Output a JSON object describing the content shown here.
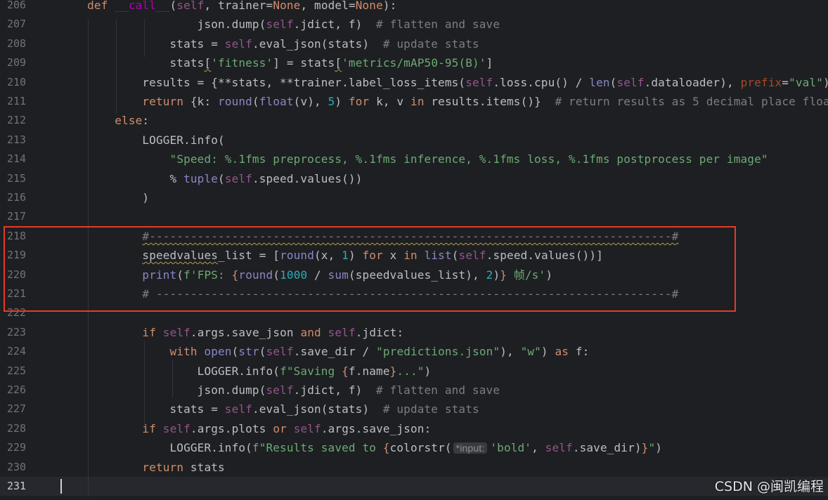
{
  "editor": {
    "current_line": "231",
    "lines": [
      {
        "n": "206",
        "tokens": [
          {
            "t": "    ",
            "c": ""
          },
          {
            "t": "def",
            "c": "kw"
          },
          {
            "t": " ",
            "c": ""
          },
          {
            "t": "__call__",
            "c": "dn"
          },
          {
            "t": "(",
            "c": ""
          },
          {
            "t": "self",
            "c": "sf"
          },
          {
            "t": ", trainer=",
            "c": ""
          },
          {
            "t": "None",
            "c": "kw"
          },
          {
            "t": ", model=",
            "c": ""
          },
          {
            "t": "None",
            "c": "kw"
          },
          {
            "t": "):",
            "c": ""
          }
        ]
      },
      {
        "n": "207",
        "tokens": [
          {
            "t": "                    json.dump(",
            "c": ""
          },
          {
            "t": "self",
            "c": "sf"
          },
          {
            "t": ".jdict, f)  ",
            "c": ""
          },
          {
            "t": "# flatten and save",
            "c": "cm"
          }
        ]
      },
      {
        "n": "208",
        "tokens": [
          {
            "t": "                stats = ",
            "c": ""
          },
          {
            "t": "self",
            "c": "sf"
          },
          {
            "t": ".eval_json(stats)  ",
            "c": ""
          },
          {
            "t": "# update stats",
            "c": "cm"
          }
        ]
      },
      {
        "n": "209",
        "tokens": [
          {
            "t": "                stats",
            "c": ""
          },
          {
            "t": "[",
            "c": "wv"
          },
          {
            "t": "'fitness'",
            "c": "st"
          },
          {
            "t": "] = stats",
            "c": ""
          },
          {
            "t": "[",
            "c": "wv"
          },
          {
            "t": "'metrics/mAP50-95(B)'",
            "c": "st"
          },
          {
            "t": "]",
            "c": ""
          }
        ]
      },
      {
        "n": "210",
        "tokens": [
          {
            "t": "            results = {**stats, **trainer.label_loss_items(",
            "c": ""
          },
          {
            "t": "self",
            "c": "sf"
          },
          {
            "t": ".loss.cpu() / ",
            "c": ""
          },
          {
            "t": "len",
            "c": "bi"
          },
          {
            "t": "(",
            "c": ""
          },
          {
            "t": "self",
            "c": "sf"
          },
          {
            "t": ".dataloader), ",
            "c": ""
          },
          {
            "t": "prefix",
            "c": "pm"
          },
          {
            "t": "=",
            "c": ""
          },
          {
            "t": "\"val\"",
            "c": "st"
          },
          {
            "t": ")}",
            "c": ""
          }
        ]
      },
      {
        "n": "211",
        "tokens": [
          {
            "t": "            ",
            "c": ""
          },
          {
            "t": "return",
            "c": "kw"
          },
          {
            "t": " {k: ",
            "c": ""
          },
          {
            "t": "round",
            "c": "bi"
          },
          {
            "t": "(",
            "c": ""
          },
          {
            "t": "float",
            "c": "bi"
          },
          {
            "t": "(v), ",
            "c": ""
          },
          {
            "t": "5",
            "c": "nm"
          },
          {
            "t": ") ",
            "c": ""
          },
          {
            "t": "for",
            "c": "kw"
          },
          {
            "t": " k, v ",
            "c": ""
          },
          {
            "t": "in",
            "c": "kw"
          },
          {
            "t": " results.items()}  ",
            "c": ""
          },
          {
            "t": "# return results as 5 decimal place floats",
            "c": "cm"
          }
        ]
      },
      {
        "n": "212",
        "tokens": [
          {
            "t": "        ",
            "c": ""
          },
          {
            "t": "else",
            "c": "kw"
          },
          {
            "t": ":",
            "c": ""
          }
        ]
      },
      {
        "n": "213",
        "tokens": [
          {
            "t": "            LOGGER.info(",
            "c": ""
          }
        ]
      },
      {
        "n": "214",
        "tokens": [
          {
            "t": "                ",
            "c": ""
          },
          {
            "t": "\"Speed: %.1fms preprocess, %.1fms inference, %.1fms loss, %.1fms postprocess per image\"",
            "c": "st"
          }
        ]
      },
      {
        "n": "215",
        "tokens": [
          {
            "t": "                % ",
            "c": ""
          },
          {
            "t": "tuple",
            "c": "bi"
          },
          {
            "t": "(",
            "c": ""
          },
          {
            "t": "self",
            "c": "sf"
          },
          {
            "t": ".speed.values())",
            "c": ""
          }
        ]
      },
      {
        "n": "216",
        "tokens": [
          {
            "t": "            )",
            "c": ""
          }
        ]
      },
      {
        "n": "217",
        "tokens": []
      },
      {
        "n": "218",
        "tokens": [
          {
            "t": "            ",
            "c": ""
          },
          {
            "t": "#----------------------------------------------------------------------------#",
            "c": "cm wv"
          }
        ]
      },
      {
        "n": "219",
        "tokens": [
          {
            "t": "            ",
            "c": ""
          },
          {
            "t": "speedvalues",
            "c": "wv"
          },
          {
            "t": "_list = [",
            "c": ""
          },
          {
            "t": "round",
            "c": "bi"
          },
          {
            "t": "(x, ",
            "c": ""
          },
          {
            "t": "1",
            "c": "nm"
          },
          {
            "t": ") ",
            "c": ""
          },
          {
            "t": "for",
            "c": "kw"
          },
          {
            "t": " x ",
            "c": ""
          },
          {
            "t": "in",
            "c": "kw"
          },
          {
            "t": " ",
            "c": ""
          },
          {
            "t": "list",
            "c": "bi"
          },
          {
            "t": "(",
            "c": ""
          },
          {
            "t": "self",
            "c": "sf"
          },
          {
            "t": ".speed.values())]",
            "c": ""
          }
        ]
      },
      {
        "n": "220",
        "tokens": [
          {
            "t": "            ",
            "c": ""
          },
          {
            "t": "print",
            "c": "bi"
          },
          {
            "t": "(",
            "c": ""
          },
          {
            "t": "f'FPS: ",
            "c": "st"
          },
          {
            "t": "{",
            "c": "kw"
          },
          {
            "t": "round",
            "c": "bi"
          },
          {
            "t": "(",
            "c": ""
          },
          {
            "t": "1000",
            "c": "nm"
          },
          {
            "t": " / ",
            "c": ""
          },
          {
            "t": "sum",
            "c": "bi"
          },
          {
            "t": "(speedvalues_list), ",
            "c": ""
          },
          {
            "t": "2",
            "c": "nm"
          },
          {
            "t": ")",
            "c": ""
          },
          {
            "t": "}",
            "c": "kw"
          },
          {
            "t": " 帧/s'",
            "c": "st"
          },
          {
            "t": ")",
            "c": ""
          }
        ]
      },
      {
        "n": "221",
        "tokens": [
          {
            "t": "            ",
            "c": ""
          },
          {
            "t": "# ---------------------------------------------------------------------------#",
            "c": "cm"
          }
        ]
      },
      {
        "n": "222",
        "tokens": []
      },
      {
        "n": "223",
        "tokens": [
          {
            "t": "            ",
            "c": ""
          },
          {
            "t": "if",
            "c": "kw"
          },
          {
            "t": " ",
            "c": ""
          },
          {
            "t": "self",
            "c": "sf"
          },
          {
            "t": ".args.save_json ",
            "c": ""
          },
          {
            "t": "and",
            "c": "kw"
          },
          {
            "t": " ",
            "c": ""
          },
          {
            "t": "self",
            "c": "sf"
          },
          {
            "t": ".jdict:",
            "c": ""
          }
        ]
      },
      {
        "n": "224",
        "tokens": [
          {
            "t": "                ",
            "c": ""
          },
          {
            "t": "with",
            "c": "kw"
          },
          {
            "t": " ",
            "c": ""
          },
          {
            "t": "open",
            "c": "bi"
          },
          {
            "t": "(",
            "c": ""
          },
          {
            "t": "str",
            "c": "bi"
          },
          {
            "t": "(",
            "c": ""
          },
          {
            "t": "self",
            "c": "sf"
          },
          {
            "t": ".save_dir / ",
            "c": ""
          },
          {
            "t": "\"predictions.json\"",
            "c": "st"
          },
          {
            "t": "), ",
            "c": ""
          },
          {
            "t": "\"w\"",
            "c": "st"
          },
          {
            "t": ") ",
            "c": ""
          },
          {
            "t": "as",
            "c": "kw"
          },
          {
            "t": " f:",
            "c": ""
          }
        ]
      },
      {
        "n": "225",
        "tokens": [
          {
            "t": "                    LOGGER.info(",
            "c": ""
          },
          {
            "t": "f\"Saving ",
            "c": "st"
          },
          {
            "t": "{",
            "c": "kw"
          },
          {
            "t": "f.name",
            "c": ""
          },
          {
            "t": "}",
            "c": "kw"
          },
          {
            "t": "...\"",
            "c": "st"
          },
          {
            "t": ")",
            "c": ""
          }
        ]
      },
      {
        "n": "226",
        "tokens": [
          {
            "t": "                    json.dump(",
            "c": ""
          },
          {
            "t": "self",
            "c": "sf"
          },
          {
            "t": ".jdict, f)  ",
            "c": ""
          },
          {
            "t": "# flatten and save",
            "c": "cm"
          }
        ]
      },
      {
        "n": "227",
        "tokens": [
          {
            "t": "                stats = ",
            "c": ""
          },
          {
            "t": "self",
            "c": "sf"
          },
          {
            "t": ".eval_json(stats)  ",
            "c": ""
          },
          {
            "t": "# update stats",
            "c": "cm"
          }
        ]
      },
      {
        "n": "228",
        "tokens": [
          {
            "t": "            ",
            "c": ""
          },
          {
            "t": "if",
            "c": "kw"
          },
          {
            "t": " ",
            "c": ""
          },
          {
            "t": "self",
            "c": "sf"
          },
          {
            "t": ".args.plots ",
            "c": ""
          },
          {
            "t": "or",
            "c": "kw"
          },
          {
            "t": " ",
            "c": ""
          },
          {
            "t": "self",
            "c": "sf"
          },
          {
            "t": ".args.save_json:",
            "c": ""
          }
        ]
      },
      {
        "n": "229",
        "tokens": [
          {
            "t": "                LOGGER.info(",
            "c": ""
          },
          {
            "t": "f\"Results saved to ",
            "c": "st"
          },
          {
            "t": "{",
            "c": "kw"
          },
          {
            "t": "colorstr(",
            "c": ""
          },
          {
            "t": "*input:",
            "c": "hint"
          },
          {
            "t": "'bold'",
            "c": "st"
          },
          {
            "t": ", ",
            "c": ""
          },
          {
            "t": "self",
            "c": "sf"
          },
          {
            "t": ".save_dir)",
            "c": ""
          },
          {
            "t": "}",
            "c": "kw"
          },
          {
            "t": "\"",
            "c": "st"
          },
          {
            "t": ")",
            "c": ""
          }
        ]
      },
      {
        "n": "230",
        "tokens": [
          {
            "t": "            ",
            "c": ""
          },
          {
            "t": "return",
            "c": "kw"
          },
          {
            "t": " stats",
            "c": ""
          }
        ]
      },
      {
        "n": "231",
        "tokens": []
      }
    ]
  },
  "watermark": "CSDN @闽凯编程"
}
